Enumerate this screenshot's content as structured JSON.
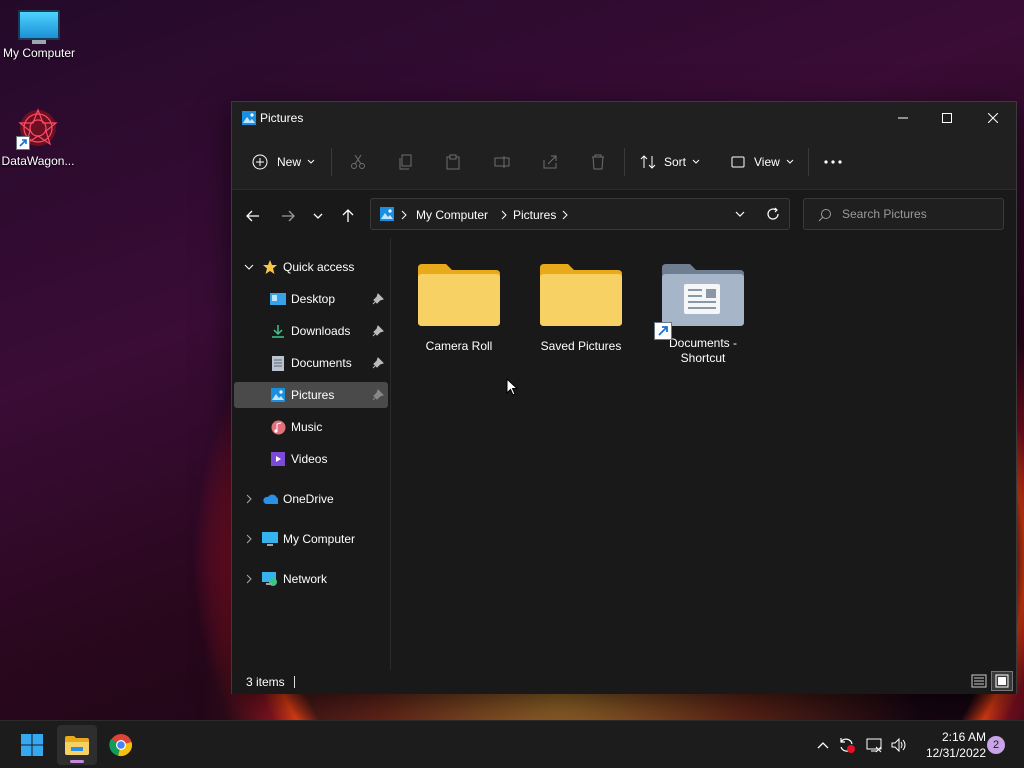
{
  "desktop": {
    "icons": [
      {
        "label": "My Computer",
        "icon": "monitor-icon"
      },
      {
        "label": "DataWagon...",
        "icon": "datawagon-app-icon"
      }
    ]
  },
  "window": {
    "title": "Pictures",
    "controls": {
      "minimize": "minimize-icon",
      "maximize": "maximize-icon",
      "close": "close-icon"
    }
  },
  "toolbar": {
    "new_label": "New",
    "sort_label": "Sort",
    "view_label": "View",
    "disabled_actions": [
      "cut",
      "copy",
      "paste",
      "rename",
      "share",
      "delete"
    ]
  },
  "address": {
    "crumbs": [
      "My Computer",
      "Pictures"
    ]
  },
  "search": {
    "placeholder": "Search Pictures"
  },
  "sidebar": {
    "quick_access": "Quick access",
    "items": [
      {
        "label": "Desktop",
        "pinned": true
      },
      {
        "label": "Downloads",
        "pinned": true
      },
      {
        "label": "Documents",
        "pinned": true
      },
      {
        "label": "Pictures",
        "pinned": true,
        "selected": true
      },
      {
        "label": "Music",
        "pinned": false
      },
      {
        "label": "Videos",
        "pinned": false
      }
    ],
    "roots": [
      {
        "label": "OneDrive"
      },
      {
        "label": "My Computer"
      },
      {
        "label": "Network"
      }
    ]
  },
  "content": {
    "items": [
      {
        "label": "Camera Roll",
        "type": "folder"
      },
      {
        "label": "Saved Pictures",
        "type": "folder"
      },
      {
        "label": "Documents - Shortcut",
        "type": "shortcut"
      }
    ]
  },
  "status": {
    "count": "3 items"
  },
  "taskbar": {
    "apps": [
      "start-icon",
      "file-explorer-icon",
      "chrome-icon"
    ],
    "time": "2:16 AM",
    "date": "12/31/2022",
    "notifications": "2"
  },
  "colors": {
    "window_bg": "#191919",
    "selection": "#4a4a4a",
    "folder_yellow": "#f6c744",
    "accent": "#0a84ff"
  }
}
